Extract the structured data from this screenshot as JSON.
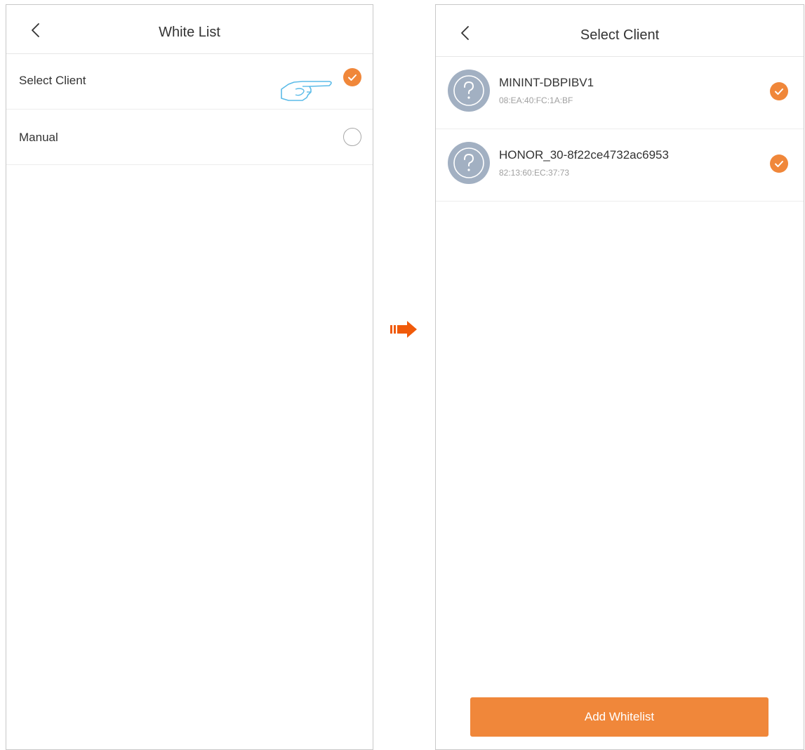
{
  "left_screen": {
    "header": {
      "title": "White List"
    },
    "options": [
      {
        "label": "Select Client",
        "selected": true
      },
      {
        "label": "Manual",
        "selected": false
      }
    ]
  },
  "right_screen": {
    "header": {
      "title": "Select Client"
    },
    "clients": [
      {
        "name": "MININT-DBPIBV1",
        "mac": "08:EA:40:FC:1A:BF",
        "selected": true
      },
      {
        "name": "HONOR_30-8f22ce4732ac6953",
        "mac": "82:13:60:EC:37:73",
        "selected": true
      }
    ],
    "add_button_label": "Add Whitelist"
  },
  "colors": {
    "accent": "#f0873a",
    "arrow": "#f05a0a",
    "avatar": "#a2b0c2",
    "hand_outline": "#5bbbe8"
  },
  "icons": {
    "back": "chevron-left-icon",
    "selected": "checkmark-circle-icon",
    "unselected": "empty-circle-icon",
    "client_avatar": "question-mark-icon",
    "pointer": "pointing-hand-icon",
    "transition": "right-arrow-icon"
  }
}
